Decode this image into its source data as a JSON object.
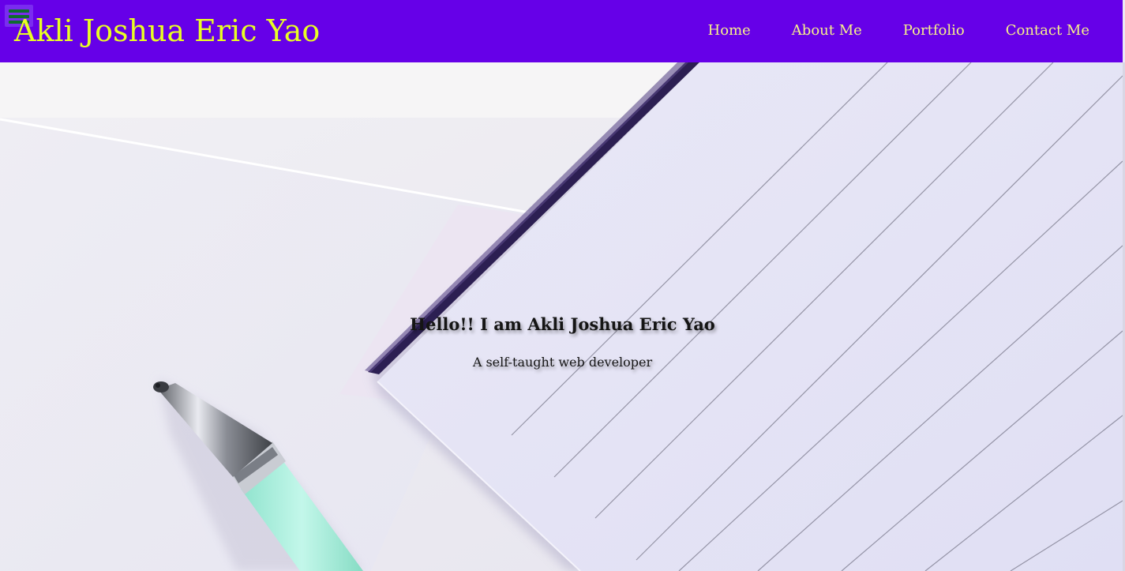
{
  "header": {
    "site_title": "Akli Joshua Eric Yao",
    "menu_icon": "hamburger-menu-icon",
    "nav": [
      {
        "label": "Home"
      },
      {
        "label": "About Me"
      },
      {
        "label": "Portfolio"
      },
      {
        "label": "Contact Me"
      }
    ]
  },
  "hero": {
    "heading": "Hello!! I am Akli Joshua Eric Yao",
    "subheading": "A self-taught web developer"
  },
  "colors": {
    "header_bg": "#6600e8",
    "title": "#e8ff23",
    "nav_text": "#f7f28a",
    "menu_icon": "#0f6b2f",
    "pen_grip": "#a8f0dd"
  }
}
